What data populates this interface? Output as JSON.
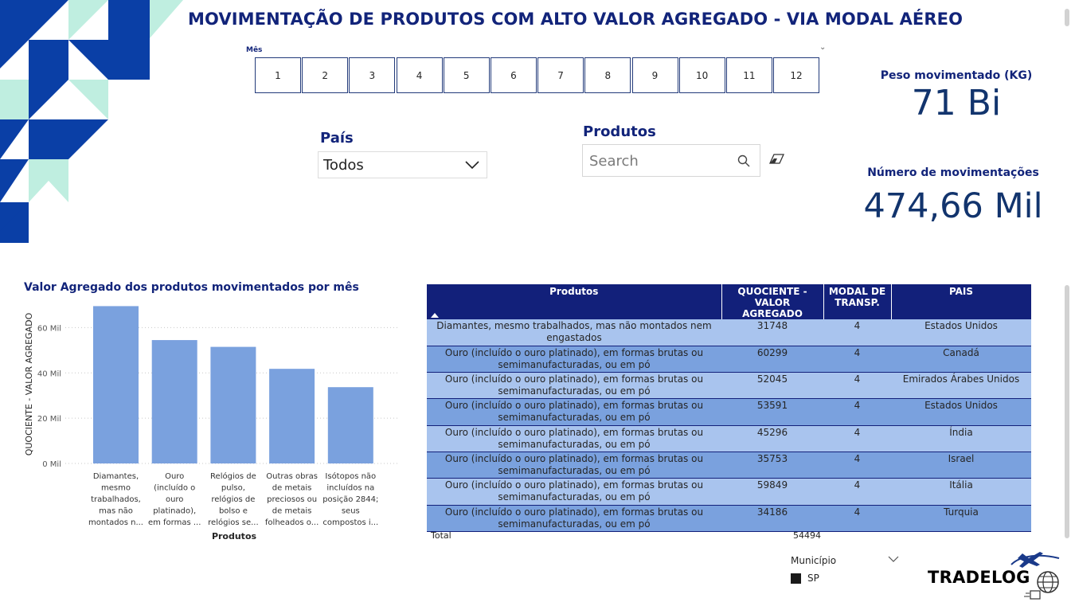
{
  "title": "MOVIMENTAÇÃO DE PRODUTOS COM ALTO VALOR AGREGADO - VIA MODAL AÉREO",
  "mes_slicer": {
    "label": "Mês",
    "months": [
      "1",
      "2",
      "3",
      "4",
      "5",
      "6",
      "7",
      "8",
      "9",
      "10",
      "11",
      "12"
    ]
  },
  "pais": {
    "label": "País",
    "selected": "Todos"
  },
  "produtos": {
    "label": "Produtos",
    "placeholder": "Search"
  },
  "kpis": {
    "peso_label": "Peso movimentado (KG)",
    "peso_value": "71 Bi",
    "mov_label": "Número de movimentações",
    "mov_value": "474,66 Mil"
  },
  "chart_data": {
    "type": "bar",
    "title": "Valor Agregado dos produtos movimentados por mês",
    "xlabel": "Produtos",
    "ylabel": "QUOCIENTE - VALOR AGREGADO",
    "ylim": [
      0,
      70000
    ],
    "yticks": [
      0,
      20000,
      40000,
      60000
    ],
    "ytick_labels": [
      "0 Mil",
      "20 Mil",
      "40 Mil",
      "60 Mil"
    ],
    "grid": true,
    "color": "#7aa1de",
    "categories": [
      [
        "Diamantes,",
        "mesmo",
        "trabalhados,",
        "mas não",
        "montados n..."
      ],
      [
        "Ouro",
        "(incluído o",
        "ouro",
        "platinado),",
        "em formas ..."
      ],
      [
        "Relógios de",
        "pulso,",
        "relógios de",
        "bolso e",
        "relógios se..."
      ],
      [
        "Outras obras",
        "de metais",
        "preciosos ou",
        "de metais",
        "folheados o..."
      ],
      [
        "Isótopos não",
        "incluídos na",
        "posição 2844;",
        "seus",
        "compostos i..."
      ]
    ],
    "values": [
      69500,
      54500,
      51500,
      41800,
      33700
    ]
  },
  "table": {
    "headers": {
      "produtos": "Produtos",
      "quociente": "QUOCIENTE - VALOR AGREGADO",
      "modal": "MODAL DE TRANSP.",
      "pais": "PAIS"
    },
    "rows": [
      {
        "produto": "Diamantes, mesmo trabalhados, mas não montados nem engastados",
        "quociente": "31748",
        "modal": "4",
        "pais": "Estados Unidos"
      },
      {
        "produto": "Ouro (incluído o ouro platinado), em formas brutas ou semimanufacturadas, ou em pó",
        "quociente": "60299",
        "modal": "4",
        "pais": "Canadá"
      },
      {
        "produto": "Ouro (incluído o ouro platinado), em formas brutas ou semimanufacturadas, ou em pó",
        "quociente": "52045",
        "modal": "4",
        "pais": "Emirados Árabes Unidos"
      },
      {
        "produto": "Ouro (incluído o ouro platinado), em formas brutas ou semimanufacturadas, ou em pó",
        "quociente": "53591",
        "modal": "4",
        "pais": "Estados Unidos"
      },
      {
        "produto": "Ouro (incluído o ouro platinado), em formas brutas ou semimanufacturadas, ou em pó",
        "quociente": "45296",
        "modal": "4",
        "pais": "Índia"
      },
      {
        "produto": "Ouro (incluído o ouro platinado), em formas brutas ou semimanufacturadas, ou em pó",
        "quociente": "35753",
        "modal": "4",
        "pais": "Israel"
      },
      {
        "produto": "Ouro (incluído o ouro platinado), em formas brutas ou semimanufacturadas, ou em pó",
        "quociente": "59849",
        "modal": "4",
        "pais": "Itália"
      },
      {
        "produto": "Ouro (incluído o ouro platinado), em formas brutas ou semimanufacturadas, ou em pó",
        "quociente": "34186",
        "modal": "4",
        "pais": "Turquia"
      }
    ],
    "total_label": "Total",
    "total_value": "54494"
  },
  "municipio": {
    "label": "Município",
    "items": [
      "SP"
    ]
  },
  "logo": {
    "text": "TRADELOG"
  },
  "colors": {
    "title": "#12247a",
    "header_bg": "#12207a",
    "row_light": "#a9c4ee",
    "row_dark": "#7aa1de",
    "corner_blue": "#0a3fa6",
    "corner_mint": "#bfeee0"
  }
}
